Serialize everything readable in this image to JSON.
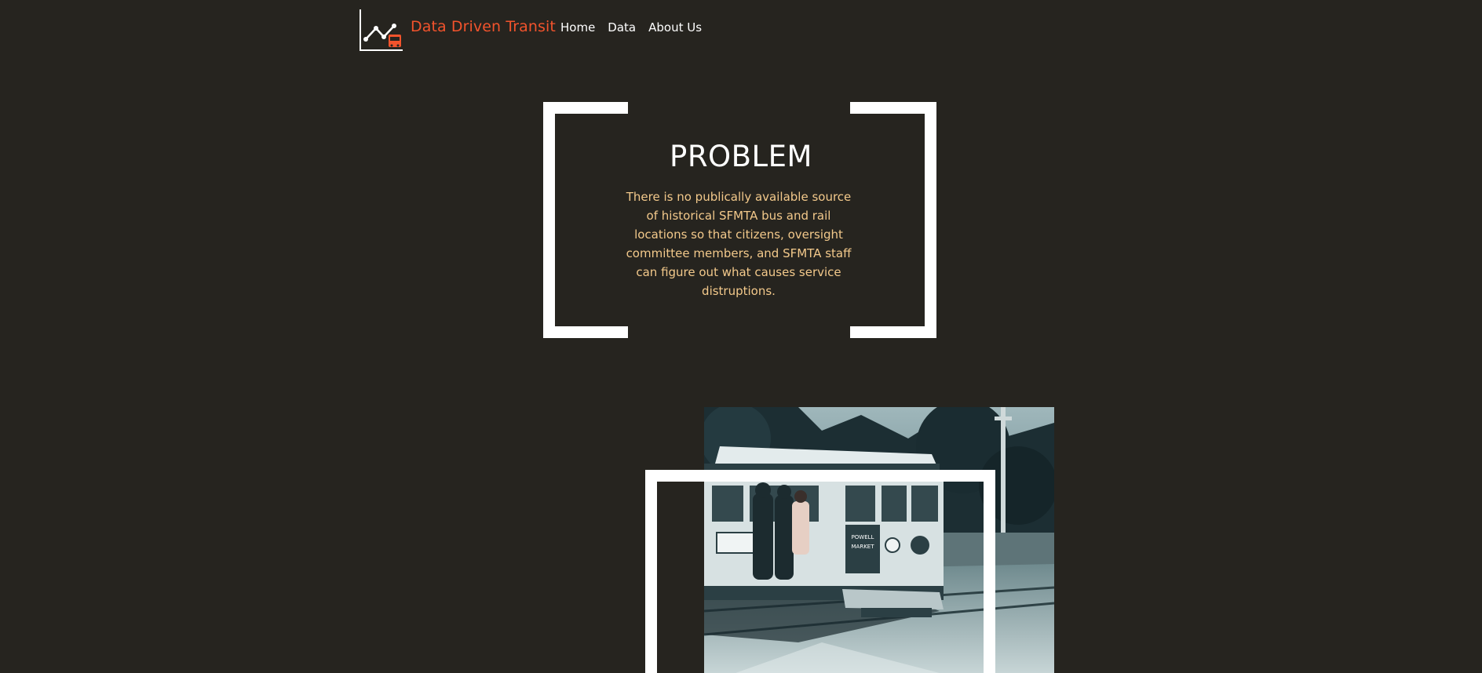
{
  "header": {
    "logo_icon": "line-chart-with-bus-icon",
    "brand": "Data Driven Transit",
    "nav": [
      {
        "label": "Home"
      },
      {
        "label": "Data"
      },
      {
        "label": "About Us"
      }
    ]
  },
  "problem": {
    "title": "PROBLEM",
    "text": "There is no publically available source of historical SFMTA bus and rail locations so that citizens, oversight committee members, and SFMTA staff can figure out what causes service distruptions."
  },
  "photo": {
    "subject": "cable-car-photo",
    "sign_line1": "POWELL",
    "sign_line2": "MARKET"
  },
  "colors": {
    "background": "#26241f",
    "brand": "#f2532c",
    "body_text": "#f3c98b",
    "frame": "#ffffff"
  }
}
